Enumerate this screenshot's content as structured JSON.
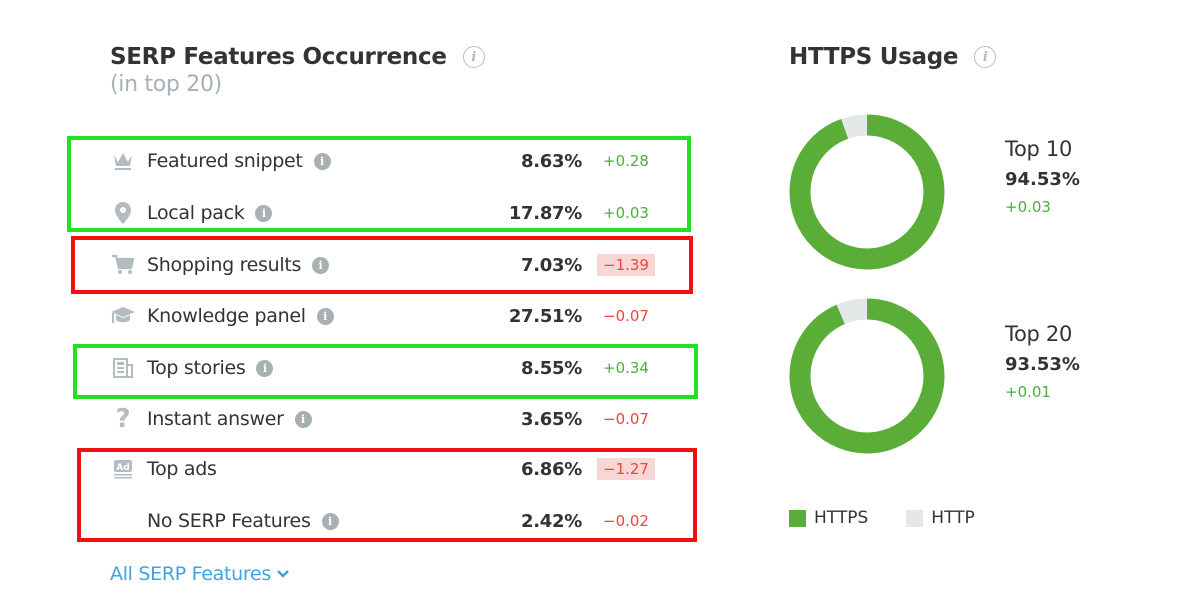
{
  "serp": {
    "title": "SERP Features Occurrence",
    "subtitle": "(in top 20)",
    "rows": [
      {
        "icon": "crown-icon",
        "label": "Featured snippet",
        "info": true,
        "percent": "8.63%",
        "change": "+0.28",
        "trend": "positive"
      },
      {
        "icon": "map-pin-icon",
        "label": "Local pack",
        "info": true,
        "percent": "17.87%",
        "change": "+0.03",
        "trend": "positive"
      },
      {
        "icon": "shopping-cart-icon",
        "label": "Shopping results",
        "info": true,
        "percent": "7.03%",
        "change": "−1.39",
        "trend": "negative-highlight"
      },
      {
        "icon": "graduation-cap-icon",
        "label": "Knowledge panel",
        "info": true,
        "percent": "27.51%",
        "change": "−0.07",
        "trend": "negative"
      },
      {
        "icon": "newspaper-icon",
        "label": "Top stories",
        "info": true,
        "percent": "8.55%",
        "change": "+0.34",
        "trend": "positive"
      },
      {
        "icon": "question-mark-icon",
        "label": "Instant answer",
        "info": true,
        "percent": "3.65%",
        "change": "−0.07",
        "trend": "negative"
      },
      {
        "icon": "ad-icon",
        "label": "Top ads",
        "info": false,
        "percent": "6.86%",
        "change": "−1.27",
        "trend": "negative-highlight"
      },
      {
        "icon": "",
        "label": "No SERP Features",
        "info": true,
        "percent": "2.42%",
        "change": "−0.02",
        "trend": "negative"
      }
    ],
    "all_link": "All SERP Features"
  },
  "https": {
    "title": "HTTPS Usage",
    "charts": [
      {
        "label": "Top 10",
        "value": "94.53%",
        "change": "+0.03",
        "https_pct": 94.53
      },
      {
        "label": "Top 20",
        "value": "93.53%",
        "change": "+0.01",
        "https_pct": 93.53
      }
    ],
    "legend": [
      {
        "label": "HTTPS",
        "color": "#5aad36"
      },
      {
        "label": "HTTP",
        "color": "#e3e7e8"
      }
    ]
  },
  "colors": {
    "positive": "#4caf3a",
    "negative": "#f0443a",
    "link": "#3ea3e0",
    "annotation_green": "#22e022",
    "annotation_red": "#f01010"
  }
}
